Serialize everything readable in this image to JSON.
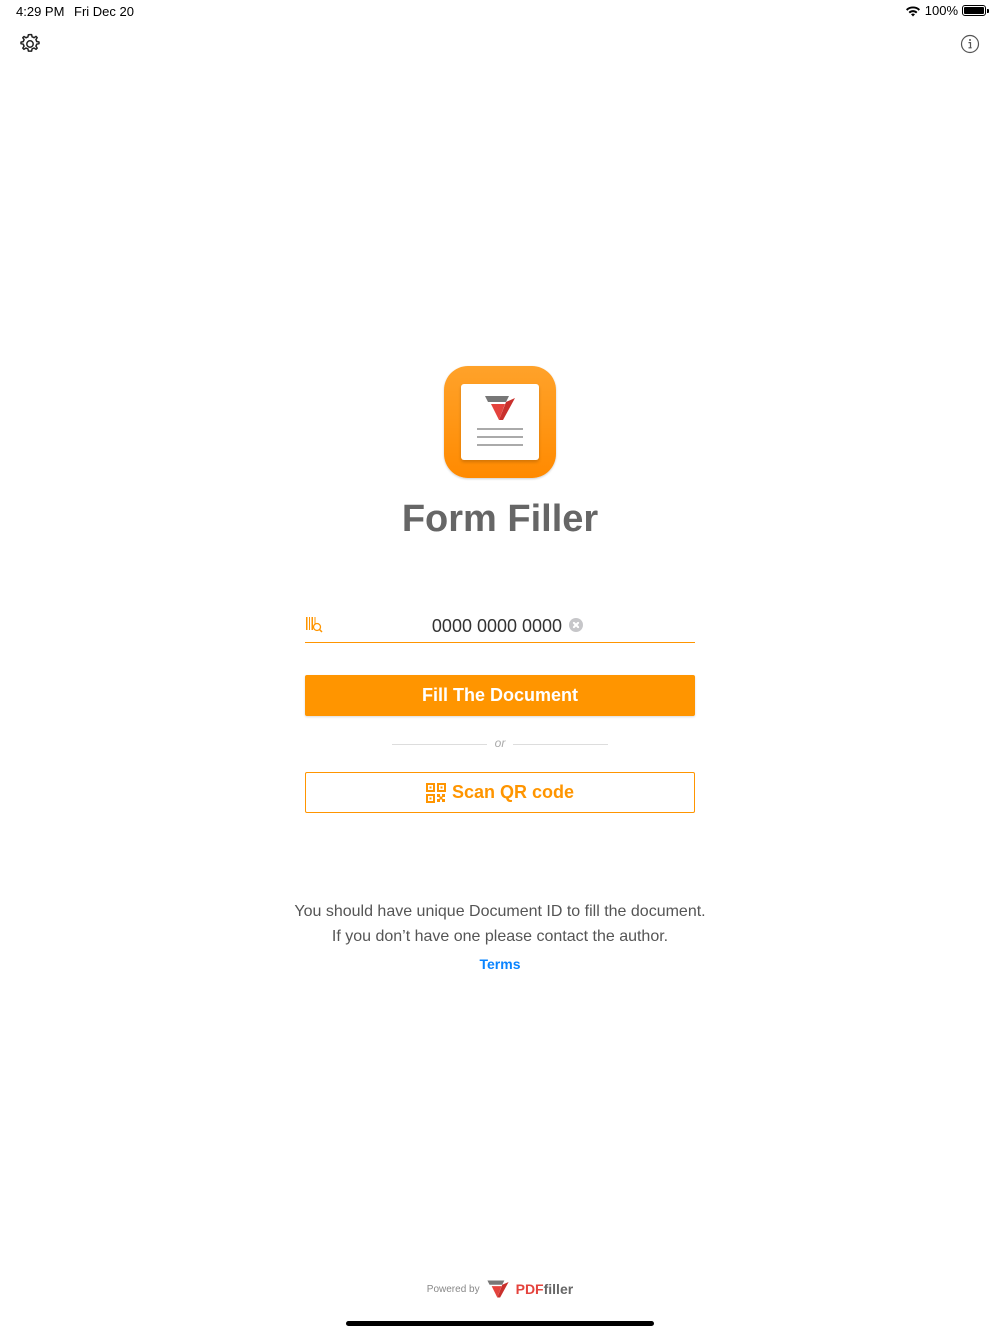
{
  "status_bar": {
    "time": "4:29 PM",
    "date": "Fri Dec 20",
    "battery": "100%",
    "battery_level": 1.0
  },
  "header": {
    "settings_icon": "gear-icon",
    "info_icon": "info-icon"
  },
  "app": {
    "title": "Form Filler",
    "accent_color": "#ff9500"
  },
  "document_id": {
    "value": "0000 0000 0000",
    "field_icon": "barcode-search-icon"
  },
  "actions": {
    "fill_label": "Fill The Document",
    "or_label": "or",
    "scan_label": "Scan QR code"
  },
  "info": {
    "line1": "You should have unique Document ID to fill the document.",
    "line2": "If you don’t have one please contact the author.",
    "terms_label": "Terms",
    "link_color": "#0a84ff"
  },
  "footer": {
    "powered_by": "Powered by",
    "brand_pdf": "PDF",
    "brand_filler": "filler"
  }
}
